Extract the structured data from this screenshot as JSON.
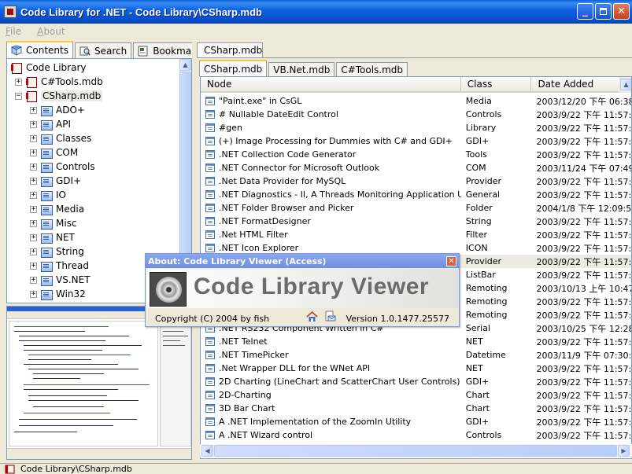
{
  "window": {
    "title": "Code Library for .NET - Code Library\\CSharp.mdb"
  },
  "menu": {
    "file": "File",
    "about": "About"
  },
  "left_tabs": [
    {
      "label": "Contents"
    },
    {
      "label": "Search"
    },
    {
      "label": "Bookmark"
    }
  ],
  "tree": {
    "root": "Code Library",
    "db1": "C#Tools.mdb",
    "db2": "CSharp.mdb",
    "folders": [
      "ADO+",
      "API",
      "Classes",
      "COM",
      "Controls",
      "GDI+",
      "IO",
      "Media",
      "Misc",
      "NET",
      "String",
      "Thread",
      "VS.NET",
      "Win32"
    ]
  },
  "doc_tab": {
    "label": "CSharp.mdb"
  },
  "inner_tabs": [
    {
      "label": "CSharp.mdb"
    },
    {
      "label": "VB.Net.mdb"
    },
    {
      "label": "C#Tools.mdb"
    }
  ],
  "list": {
    "headers": {
      "node": "Node",
      "class": "Class",
      "date": "Date Added"
    },
    "rows": [
      {
        "node": "\"Paint.exe\" in CsGL",
        "class": "Media",
        "date": "2003/12/20 下午 06:38:"
      },
      {
        "node": "# Nullable DateEdit Control",
        "class": "Controls",
        "date": "2003/9/22 下午 11:57:5"
      },
      {
        "node": "#gen",
        "class": "Library",
        "date": "2003/9/22 下午 11:57:5"
      },
      {
        "node": "(+) Image Processing for Dummies with C# and GDI+",
        "class": "GDI+",
        "date": "2003/9/22 下午 11:57:5"
      },
      {
        "node": ".NET Collection Code Generator",
        "class": "Tools",
        "date": "2003/9/22 下午 11:57:5"
      },
      {
        "node": ".NET Connector for Microsoft Outlook",
        "class": "COM",
        "date": "2003/11/24 下午 07:49:"
      },
      {
        "node": ".Net Data Provider for MySQL",
        "class": "Provider",
        "date": "2003/9/22 下午 11:57:5"
      },
      {
        "node": ".NET Diagnostics - II, A Threads Monitoring Application Using C#",
        "class": "General",
        "date": "2003/9/22 下午 11:57:5"
      },
      {
        "node": ".NET Folder Browser and Picker",
        "class": "Folder",
        "date": "2004/1/8 下午 12:09:53"
      },
      {
        "node": ".NET FormatDesigner",
        "class": "String",
        "date": "2003/9/22 下午 11:57:5"
      },
      {
        "node": ".Net HTML Filter",
        "class": "Filter",
        "date": "2003/9/22 下午 11:57:5"
      },
      {
        "node": ".NET Icon Explorer",
        "class": "ICON",
        "date": "2003/9/22 下午 11:57:5"
      },
      {
        "node": "",
        "class": "Provider",
        "date": "2003/9/22 下午 11:57:5"
      },
      {
        "node": "",
        "class": "ListBar",
        "date": "2003/9/22 下午 11:57:5"
      },
      {
        "node": "",
        "class": "Remoting",
        "date": "2003/10/13 上午 10:47:"
      },
      {
        "node": "",
        "class": "Remoting",
        "date": "2003/9/22 下午 11:57:5"
      },
      {
        "node": "",
        "class": "Remoting",
        "date": "2003/9/22 下午 11:57:5"
      },
      {
        "node": ".NET RS232 Component Written in C#",
        "class": "Serial",
        "date": "2003/10/25 下午 12:28:"
      },
      {
        "node": ".NET Telnet",
        "class": "NET",
        "date": "2003/9/22 下午 11:57:5"
      },
      {
        "node": ".NET TimePicker",
        "class": "Datetime",
        "date": "2003/11/9 下午 07:30:3"
      },
      {
        "node": ".Net Wrapper DLL for the WNet API",
        "class": "NET",
        "date": "2003/9/22 下午 11:57:5"
      },
      {
        "node": "2D Charting (LineChart and ScatterChart User Controls)",
        "class": "GDI+",
        "date": "2003/9/22 下午 11:57:5"
      },
      {
        "node": "2D-Charting",
        "class": "Chart",
        "date": "2003/9/22 下午 11:57:5"
      },
      {
        "node": "3D Bar Chart",
        "class": "Chart",
        "date": "2003/9/22 下午 11:57:5"
      },
      {
        "node": "A .NET Implementation of the ZoomIn Utility",
        "class": "GDI+",
        "date": "2003/9/22 下午 11:57:5"
      },
      {
        "node": "A .NET Wizard control",
        "class": "Controls",
        "date": "2003/9/22 下午 11:57:5"
      }
    ]
  },
  "status": {
    "path": "Code Library\\CSharp.mdb"
  },
  "about_dialog": {
    "title": "About: Code Library Viewer (Access)",
    "product": "Code Library Viewer",
    "copyright": "Copyright (C) 2004 by fish",
    "version": "Version 1.0.1477.25577"
  },
  "colors": {
    "titlebar": "#0a5fd8",
    "dialog_title": "#7b99e6",
    "selection": "#ecebe3"
  }
}
